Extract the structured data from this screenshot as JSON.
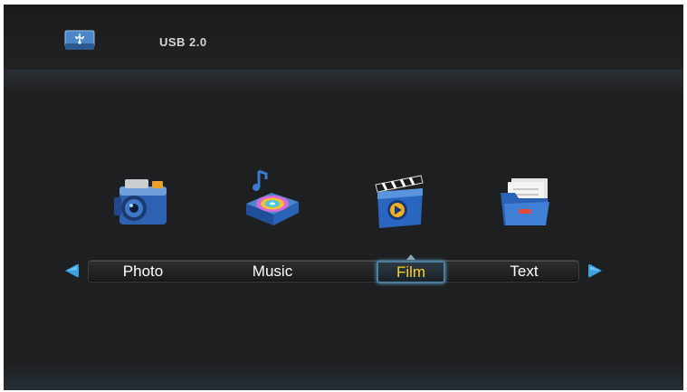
{
  "header": {
    "device_icon": "usb-drive-icon",
    "device_label": "USB 2.0"
  },
  "media_menu": {
    "items": [
      {
        "label": "Photo",
        "icon": "camera-icon"
      },
      {
        "label": "Music",
        "icon": "music-disc-icon"
      },
      {
        "label": "Film",
        "icon": "clapperboard-icon"
      },
      {
        "label": "Text",
        "icon": "document-folder-icon"
      }
    ],
    "selected_index": 2
  },
  "navigation": {
    "left_icon": "arrow-left-icon",
    "right_icon": "arrow-right-icon"
  },
  "colors": {
    "background": "#1e1f20",
    "selected_text": "#ffd21e",
    "selection_border": "#4d7f9c",
    "arrow": "#3aa0e0",
    "icon_blue": "#2a62b8"
  }
}
